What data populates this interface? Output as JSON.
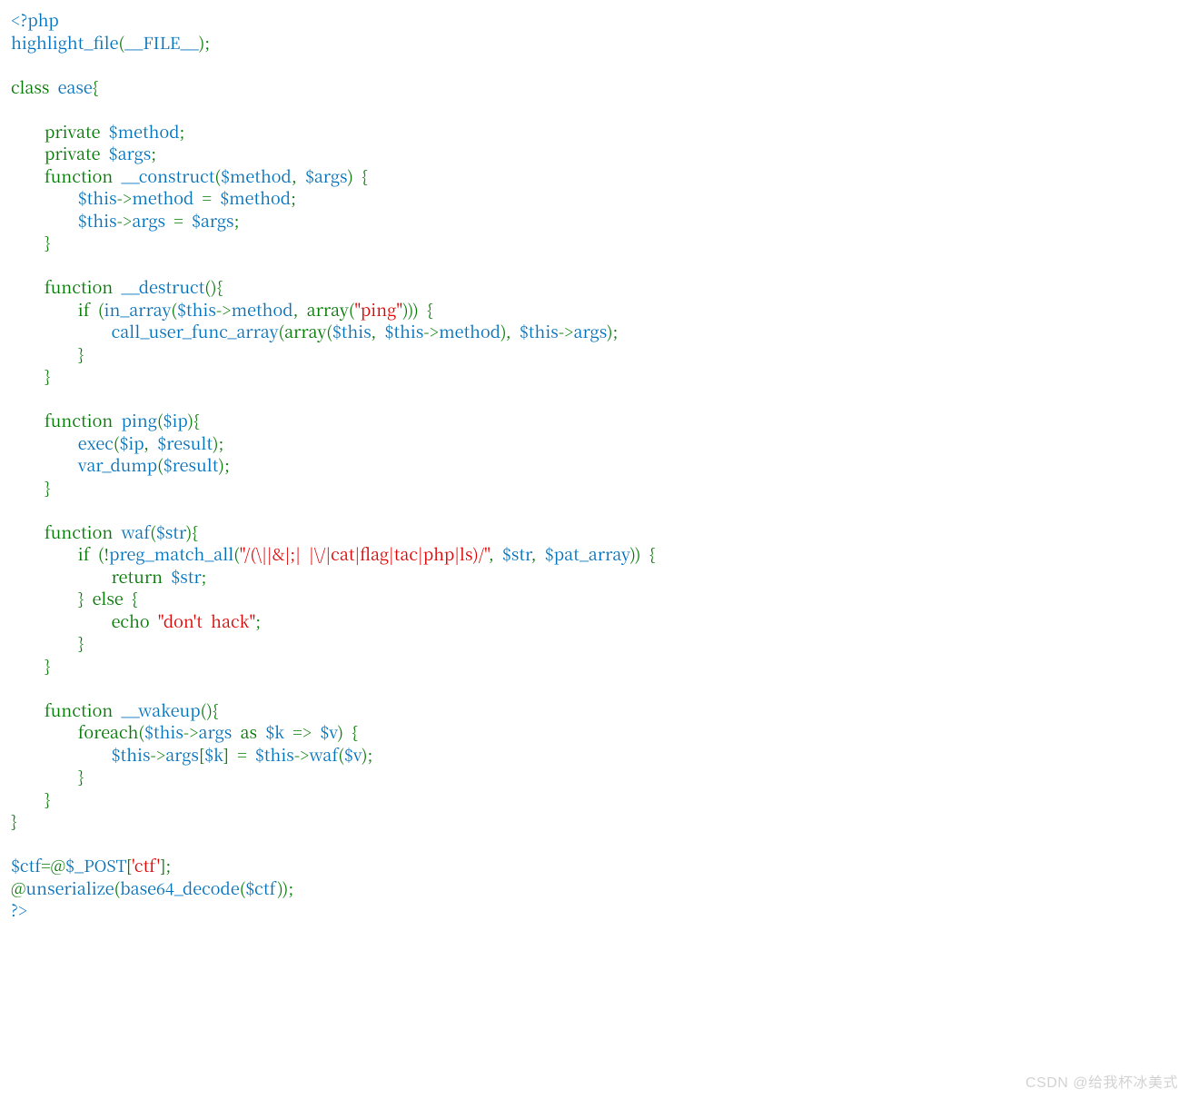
{
  "code": {
    "tokens": [
      {
        "t": "<?php",
        "c": "default"
      },
      {
        "t": "\n",
        "c": "default"
      },
      {
        "t": "highlight_file",
        "c": "default"
      },
      {
        "t": "(",
        "c": "keyword"
      },
      {
        "t": "__FILE__",
        "c": "default"
      },
      {
        "t": ");",
        "c": "keyword"
      },
      {
        "t": "\n",
        "c": "default"
      },
      {
        "t": "\n",
        "c": "default"
      },
      {
        "t": "class  ",
        "c": "keyword"
      },
      {
        "t": "ease",
        "c": "default"
      },
      {
        "t": "{",
        "c": "keyword"
      },
      {
        "t": "\n",
        "c": "default"
      },
      {
        "t": "\n",
        "c": "default"
      },
      {
        "t": "        private  ",
        "c": "keyword"
      },
      {
        "t": "$method",
        "c": "default"
      },
      {
        "t": ";",
        "c": "keyword"
      },
      {
        "t": "\n",
        "c": "default"
      },
      {
        "t": "        private  ",
        "c": "keyword"
      },
      {
        "t": "$args",
        "c": "default"
      },
      {
        "t": ";",
        "c": "keyword"
      },
      {
        "t": "\n",
        "c": "default"
      },
      {
        "t": "        function  ",
        "c": "keyword"
      },
      {
        "t": "__construct",
        "c": "default"
      },
      {
        "t": "(",
        "c": "keyword"
      },
      {
        "t": "$method",
        "c": "default"
      },
      {
        "t": ",  ",
        "c": "keyword"
      },
      {
        "t": "$args",
        "c": "default"
      },
      {
        "t": ")  {",
        "c": "keyword"
      },
      {
        "t": "\n",
        "c": "default"
      },
      {
        "t": "                ",
        "c": "default"
      },
      {
        "t": "$this",
        "c": "default"
      },
      {
        "t": "->",
        "c": "keyword"
      },
      {
        "t": "method  ",
        "c": "default"
      },
      {
        "t": "=  ",
        "c": "keyword"
      },
      {
        "t": "$method",
        "c": "default"
      },
      {
        "t": ";",
        "c": "keyword"
      },
      {
        "t": "\n",
        "c": "default"
      },
      {
        "t": "                ",
        "c": "default"
      },
      {
        "t": "$this",
        "c": "default"
      },
      {
        "t": "->",
        "c": "keyword"
      },
      {
        "t": "args  ",
        "c": "default"
      },
      {
        "t": "=  ",
        "c": "keyword"
      },
      {
        "t": "$args",
        "c": "default"
      },
      {
        "t": ";",
        "c": "keyword"
      },
      {
        "t": "\n",
        "c": "default"
      },
      {
        "t": "        }",
        "c": "keyword"
      },
      {
        "t": "\n",
        "c": "default"
      },
      {
        "t": "\n",
        "c": "default"
      },
      {
        "t": "        function  ",
        "c": "keyword"
      },
      {
        "t": "__destruct",
        "c": "default"
      },
      {
        "t": "(){",
        "c": "keyword"
      },
      {
        "t": "\n",
        "c": "default"
      },
      {
        "t": "                if  (",
        "c": "keyword"
      },
      {
        "t": "in_array",
        "c": "default"
      },
      {
        "t": "(",
        "c": "keyword"
      },
      {
        "t": "$this",
        "c": "default"
      },
      {
        "t": "->",
        "c": "keyword"
      },
      {
        "t": "method",
        "c": "default"
      },
      {
        "t": ",  array(",
        "c": "keyword"
      },
      {
        "t": "\"ping\"",
        "c": "string"
      },
      {
        "t": ")))  {",
        "c": "keyword"
      },
      {
        "t": "\n",
        "c": "default"
      },
      {
        "t": "                        ",
        "c": "default"
      },
      {
        "t": "call_user_func_array",
        "c": "default"
      },
      {
        "t": "(array(",
        "c": "keyword"
      },
      {
        "t": "$this",
        "c": "default"
      },
      {
        "t": ",  ",
        "c": "keyword"
      },
      {
        "t": "$this",
        "c": "default"
      },
      {
        "t": "->",
        "c": "keyword"
      },
      {
        "t": "method",
        "c": "default"
      },
      {
        "t": "),  ",
        "c": "keyword"
      },
      {
        "t": "$this",
        "c": "default"
      },
      {
        "t": "->",
        "c": "keyword"
      },
      {
        "t": "args",
        "c": "default"
      },
      {
        "t": ");",
        "c": "keyword"
      },
      {
        "t": "\n",
        "c": "default"
      },
      {
        "t": "                }",
        "c": "keyword"
      },
      {
        "t": "\n",
        "c": "default"
      },
      {
        "t": "        }",
        "c": "keyword"
      },
      {
        "t": "\n",
        "c": "default"
      },
      {
        "t": "\n",
        "c": "default"
      },
      {
        "t": "        function  ",
        "c": "keyword"
      },
      {
        "t": "ping",
        "c": "default"
      },
      {
        "t": "(",
        "c": "keyword"
      },
      {
        "t": "$ip",
        "c": "default"
      },
      {
        "t": "){",
        "c": "keyword"
      },
      {
        "t": "\n",
        "c": "default"
      },
      {
        "t": "                ",
        "c": "default"
      },
      {
        "t": "exec",
        "c": "default"
      },
      {
        "t": "(",
        "c": "keyword"
      },
      {
        "t": "$ip",
        "c": "default"
      },
      {
        "t": ",  ",
        "c": "keyword"
      },
      {
        "t": "$result",
        "c": "default"
      },
      {
        "t": ");",
        "c": "keyword"
      },
      {
        "t": "\n",
        "c": "default"
      },
      {
        "t": "                ",
        "c": "default"
      },
      {
        "t": "var_dump",
        "c": "default"
      },
      {
        "t": "(",
        "c": "keyword"
      },
      {
        "t": "$result",
        "c": "default"
      },
      {
        "t": ");",
        "c": "keyword"
      },
      {
        "t": "\n",
        "c": "default"
      },
      {
        "t": "        }",
        "c": "keyword"
      },
      {
        "t": "\n",
        "c": "default"
      },
      {
        "t": "\n",
        "c": "default"
      },
      {
        "t": "        function  ",
        "c": "keyword"
      },
      {
        "t": "waf",
        "c": "default"
      },
      {
        "t": "(",
        "c": "keyword"
      },
      {
        "t": "$str",
        "c": "default"
      },
      {
        "t": "){",
        "c": "keyword"
      },
      {
        "t": "\n",
        "c": "default"
      },
      {
        "t": "                if  (!",
        "c": "keyword"
      },
      {
        "t": "preg_match_all",
        "c": "default"
      },
      {
        "t": "(",
        "c": "keyword"
      },
      {
        "t": "\"/(\\||&|;|  |\\/|cat|flag|tac|php|ls)/\"",
        "c": "string"
      },
      {
        "t": ",  ",
        "c": "keyword"
      },
      {
        "t": "$str",
        "c": "default"
      },
      {
        "t": ",  ",
        "c": "keyword"
      },
      {
        "t": "$pat_array",
        "c": "default"
      },
      {
        "t": "))  {",
        "c": "keyword"
      },
      {
        "t": "\n",
        "c": "default"
      },
      {
        "t": "                        return  ",
        "c": "keyword"
      },
      {
        "t": "$str",
        "c": "default"
      },
      {
        "t": ";",
        "c": "keyword"
      },
      {
        "t": "\n",
        "c": "default"
      },
      {
        "t": "                }  else  {",
        "c": "keyword"
      },
      {
        "t": "\n",
        "c": "default"
      },
      {
        "t": "                        echo  ",
        "c": "keyword"
      },
      {
        "t": "\"don't  hack\"",
        "c": "string"
      },
      {
        "t": ";",
        "c": "keyword"
      },
      {
        "t": "\n",
        "c": "default"
      },
      {
        "t": "                }",
        "c": "keyword"
      },
      {
        "t": "\n",
        "c": "default"
      },
      {
        "t": "        }",
        "c": "keyword"
      },
      {
        "t": "\n",
        "c": "default"
      },
      {
        "t": "\n",
        "c": "default"
      },
      {
        "t": "        function  ",
        "c": "keyword"
      },
      {
        "t": "__wakeup",
        "c": "default"
      },
      {
        "t": "(){",
        "c": "keyword"
      },
      {
        "t": "\n",
        "c": "default"
      },
      {
        "t": "                foreach(",
        "c": "keyword"
      },
      {
        "t": "$this",
        "c": "default"
      },
      {
        "t": "->",
        "c": "keyword"
      },
      {
        "t": "args  ",
        "c": "default"
      },
      {
        "t": "as  ",
        "c": "keyword"
      },
      {
        "t": "$k  ",
        "c": "default"
      },
      {
        "t": "=>  ",
        "c": "keyword"
      },
      {
        "t": "$v",
        "c": "default"
      },
      {
        "t": ")  {",
        "c": "keyword"
      },
      {
        "t": "\n",
        "c": "default"
      },
      {
        "t": "                        ",
        "c": "default"
      },
      {
        "t": "$this",
        "c": "default"
      },
      {
        "t": "->",
        "c": "keyword"
      },
      {
        "t": "args",
        "c": "default"
      },
      {
        "t": "[",
        "c": "keyword"
      },
      {
        "t": "$k",
        "c": "default"
      },
      {
        "t": "]  =  ",
        "c": "keyword"
      },
      {
        "t": "$this",
        "c": "default"
      },
      {
        "t": "->",
        "c": "keyword"
      },
      {
        "t": "waf",
        "c": "default"
      },
      {
        "t": "(",
        "c": "keyword"
      },
      {
        "t": "$v",
        "c": "default"
      },
      {
        "t": ");",
        "c": "keyword"
      },
      {
        "t": "\n",
        "c": "default"
      },
      {
        "t": "                }",
        "c": "keyword"
      },
      {
        "t": "\n",
        "c": "default"
      },
      {
        "t": "        }",
        "c": "keyword"
      },
      {
        "t": "\n",
        "c": "default"
      },
      {
        "t": "}",
        "c": "keyword"
      },
      {
        "t": "\n",
        "c": "default"
      },
      {
        "t": "\n",
        "c": "default"
      },
      {
        "t": "$ctf",
        "c": "default"
      },
      {
        "t": "=@",
        "c": "keyword"
      },
      {
        "t": "$_POST",
        "c": "default"
      },
      {
        "t": "[",
        "c": "keyword"
      },
      {
        "t": "'ctf'",
        "c": "string"
      },
      {
        "t": "];",
        "c": "keyword"
      },
      {
        "t": "\n",
        "c": "default"
      },
      {
        "t": "@",
        "c": "keyword"
      },
      {
        "t": "unserialize",
        "c": "default"
      },
      {
        "t": "(",
        "c": "keyword"
      },
      {
        "t": "base64_decode",
        "c": "default"
      },
      {
        "t": "(",
        "c": "keyword"
      },
      {
        "t": "$ctf",
        "c": "default"
      },
      {
        "t": "));",
        "c": "keyword"
      },
      {
        "t": "\n",
        "c": "default"
      },
      {
        "t": "?>",
        "c": "default"
      }
    ]
  },
  "watermark": "CSDN @给我杯冰美式",
  "colors": {
    "default": "#0070BB",
    "keyword": "#007700",
    "string": "#DD0000",
    "background": "#FFFFFF"
  }
}
